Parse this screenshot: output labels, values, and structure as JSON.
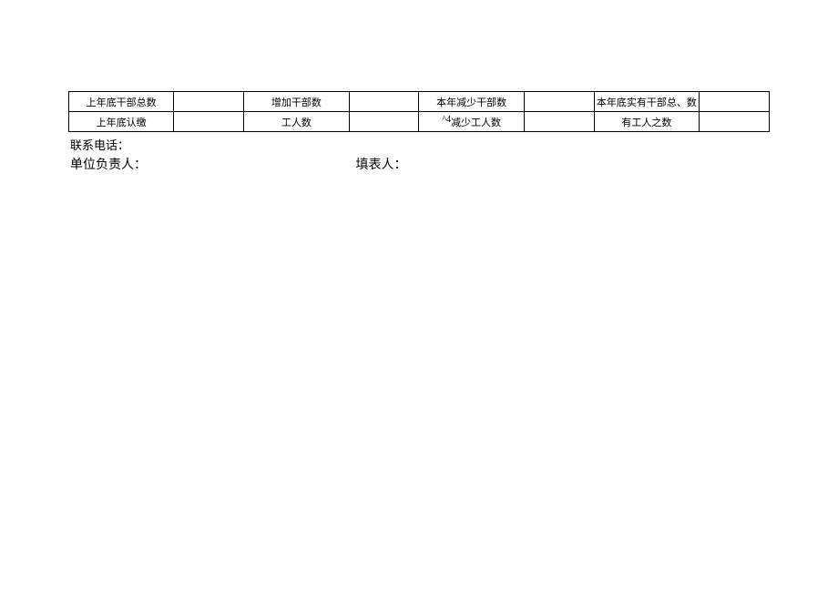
{
  "table": {
    "row1": {
      "c1_label": "上年底干部总数",
      "c1_value": "",
      "c2_label": "增加干部数",
      "c2_value": "",
      "c3_label": "本年减少干部数",
      "c3_value": "",
      "c4_label": "本年底实有干部总、数",
      "c4_value": ""
    },
    "row2": {
      "c1_label": "上年底认缴",
      "c1_value": "",
      "c2_label": "工人数",
      "c2_value": "",
      "c3_mark": "^4",
      "c3_label": "减少工人数",
      "c3_value": "",
      "c4_label": "有工人之数",
      "c4_value": ""
    }
  },
  "footer": {
    "contact_label": "联系电话：",
    "responsible_label": "单位负责人：",
    "filler_label": "填表人："
  }
}
